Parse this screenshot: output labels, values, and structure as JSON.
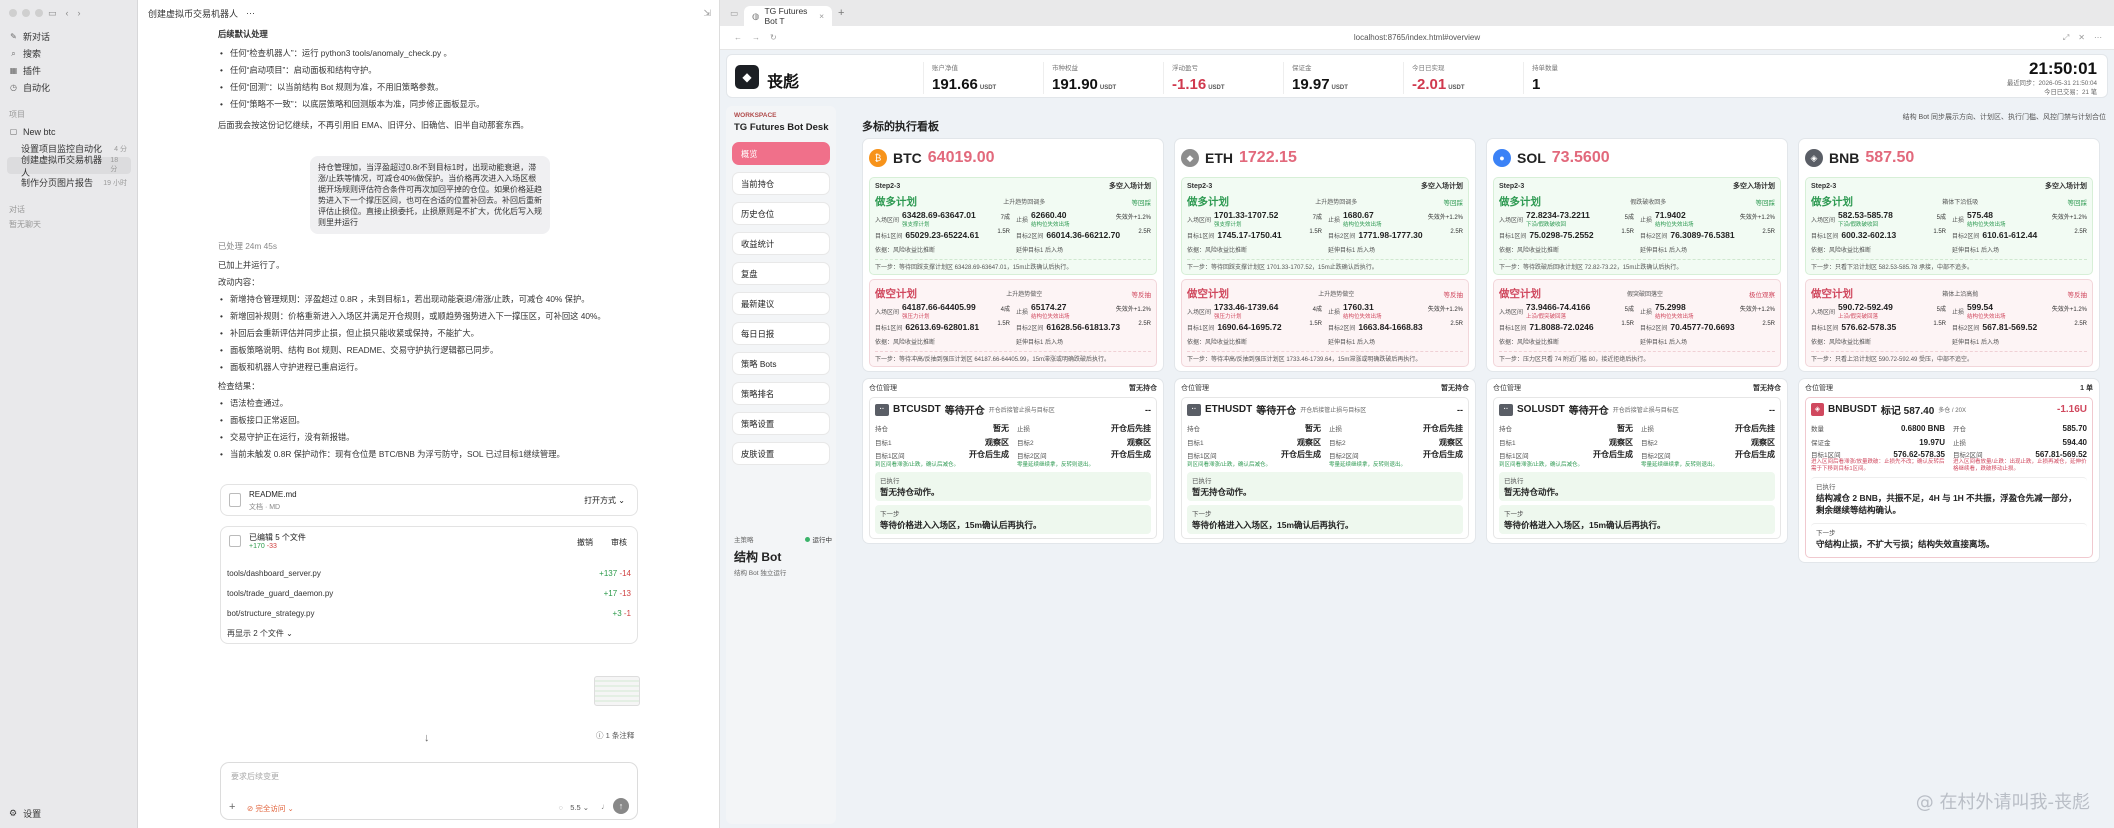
{
  "sidebar": {
    "nav": [
      {
        "icon": "compose-icon",
        "label": "新对话"
      },
      {
        "icon": "search-icon",
        "label": "搜索"
      },
      {
        "icon": "plugin-icon",
        "label": "插件"
      },
      {
        "icon": "automation-icon",
        "label": "自动化"
      }
    ],
    "projects_label": "项目",
    "project_name": "New btc",
    "threads": [
      {
        "label": "设置项目监控自动化",
        "time": "4 分"
      },
      {
        "label": "创建虚拟币交易机器人",
        "time": "18 分"
      },
      {
        "label": "制作分页图片报告",
        "time": "19 小时"
      }
    ],
    "chats_label": "对话",
    "no_chats": "暂无聊天",
    "settings": "设置"
  },
  "chat": {
    "title": "创建虚拟币交易机器人",
    "title_more": "···",
    "section1": "后续默认处理",
    "bullets1": [
      "任何“检查机器人”：运行 python3 tools/anomaly_check.py 。",
      "任何“启动项目”：启动面板和结构守护。",
      "任何“回测”：以当前结构 Bot 规则为准，不用旧策略参数。",
      "任何“策略不一致”：以底层策略和回测版本为准，同步修正面板显示。"
    ],
    "para1": "后面我会按这份记忆继续，不再引用旧 EMA、旧评分、旧确信、旧半自动那套东西。",
    "user_msg": "持仓管理加，当浮盈超过0.8r不到目标1时，出现动能衰退，滞涨/止跌等情况，可减仓40%做保护。当价格再次进入入场区根据开场规则评估符合条件可再次加回平掉的仓位。如果价格延趋势进入下一个撑压区间，也可在合适的位置补回去。补回后重新评估止损位。直接止损委托，止损原则是不扩大，优化后写入规则里并运行",
    "processed": "已处理 24m 45s",
    "done": "已加上并运行了。",
    "changes_label": "改动内容：",
    "bullets2": [
      "新增持仓管理规则：浮盈超过 0.8R ，未到目标1，若出现动能衰退/滞涨/止跌，可减仓 40% 保护。",
      "新增回补规则：价格重新进入入场区并满足开仓规则，或顺趋势强势进入下一撑压区，可补回这 40%。",
      "补回后会重新评估并同步止损，但止损只能收紧或保持，不能扩大。",
      "面板策略说明、结构 Bot 规则、README、交易守护执行逻辑都已同步。",
      "面板和机器人守护进程已重启运行。"
    ],
    "checks_label": "检查结果：",
    "bullets3": [
      "语法检查通过。",
      "面板接口正常返回。",
      "交易守护正在运行，没有新报错。",
      "当前未触发 0.8R 保护动作：现有仓位是 BTC/BNB 为浮亏防守，SOL 已过目标1继续管理。"
    ],
    "readme": {
      "name": "README.md",
      "type": "文档 · MD",
      "open": "打开方式"
    },
    "edited": {
      "title": "已编辑 5 个文件",
      "stats_plus": "+170",
      "stats_minus": "-33",
      "undo": "撤销",
      "review": "审核"
    },
    "files": [
      {
        "name": "tools/dashboard_server.py",
        "plus": "+137",
        "minus": "-14"
      },
      {
        "name": "tools/trade_guard_daemon.py",
        "plus": "+17",
        "minus": "-13"
      },
      {
        "name": "bot/structure_strategy.py",
        "plus": "+3",
        "minus": "-1"
      }
    ],
    "more_files": "再显示 2 个文件",
    "comment": "1 条注释",
    "input_placeholder": "要求后续变更",
    "access": "完全访问",
    "model": "5.5"
  },
  "browser": {
    "tab_title": "TG Futures Bot T",
    "url": "localhost:8765/index.html#overview"
  },
  "app": {
    "brand": "丧彪",
    "stats": [
      {
        "label": "账户净值",
        "value": "191.66",
        "unit": "USDT",
        "neg": false
      },
      {
        "label": "市种权益",
        "value": "191.90",
        "unit": "USDT",
        "neg": false
      },
      {
        "label": "浮动盈亏",
        "value": "-1.16",
        "unit": "USDT",
        "neg": true
      },
      {
        "label": "保证金",
        "value": "19.97",
        "unit": "USDT",
        "neg": false
      },
      {
        "label": "今日已实现",
        "value": "-2.01",
        "unit": "USDT",
        "neg": true
      },
      {
        "label": "持单数量",
        "value": "1",
        "unit": "",
        "neg": false
      }
    ],
    "clock": "21:50:01",
    "clock_sub1": "最近同步：2026-05-31 21:50:04",
    "clock_sub2": "今日已交易：21 笔",
    "workspace": "WORKSPACE",
    "workspace_title": "TG Futures Bot Desk",
    "nav": [
      "概览",
      "当前持仓",
      "历史仓位",
      "收益统计",
      "复盘",
      "最新建议",
      "每日日报",
      "策略 Bots",
      "策略排名",
      "策略设置",
      "皮肤设置"
    ],
    "bot_label": "主策略",
    "bot_status": "运行中",
    "bot_name": "结构 Bot",
    "bot_desc": "结构 Bot 独立运行",
    "main_title": "多标的执行看板",
    "main_note": "结构 Bot 同步展示方向、计划区、执行门槛、风控门禁与计划合位",
    "coins": [
      {
        "name": "BTC",
        "price": "64019.00",
        "color": "#f7931a",
        "icon": "btc-icon",
        "glyph": "₿",
        "step": "Step2-3",
        "step_r": "多空入场计划",
        "long": {
          "title": "做多计划",
          "tag": "上升趋势回调多",
          "status": "等回踩",
          "entry": "63428.69-63647.01",
          "entry_sub": "强支撑计划",
          "sl_tag": "7成",
          "sl": "62660.40",
          "sl_sub": "结构位失效出场",
          "tp_note": "失效外+1.2%",
          "t1": "65029.23-65224.61",
          "t1_rr": "1.5R",
          "t2": "66014.36-66212.70",
          "t2_rr": "2.5R",
          "basis": "依据：风险收益比推断",
          "basis_r": "延伸目标1 后入场",
          "next": "下一步：等待回踩支撑计划区 63428.69-63647.01，15m止跌确认后执行。"
        },
        "short": {
          "title": "做空计划",
          "tag": "上升趋势做空",
          "status": "等反抽",
          "entry": "64187.66-64405.99",
          "entry_sub": "强压力计划",
          "sl_tag": "4成",
          "sl": "65174.27",
          "sl_sub": "结构位失效出场",
          "tp_note": "失效外+1.2%",
          "t1": "62613.69-62801.81",
          "t1_rr": "1.5R",
          "t2": "61628.56-61813.73",
          "t2_rr": "2.5R",
          "basis": "依据：风险收益比推断",
          "basis_r": "延伸目标1 后入场",
          "next": "下一步：等待冲高/反抽到强压计划区 64187.66-64405.99，15m滞涨或明确跌破后执行。"
        },
        "pos_label": "仓位管理",
        "pos_status": "暂无持仓",
        "pos": {
          "sym": "BTCUSDT",
          "state": "等待开仓",
          "dash": "--",
          "hold": "持仓",
          "hold_v": "暂无",
          "stop": "止损",
          "stop_v": "开仓后先挂",
          "t1": "目标1",
          "t1_v": "观察区",
          "t2": "目标2",
          "t2_v": "观察区",
          "t1r": "目标1区间",
          "t1r_v": "开仓后生成",
          "t1r_g": "到区间看滞涨/止跌，确认后减仓。",
          "t2r": "目标2区间",
          "t2r_v": "开仓后生成",
          "t2r_g": "零量延续继续拿，反转则退出。",
          "exec": "已执行",
          "exec_v": "暂无持仓动作。",
          "next": "下一步",
          "next_v": "等待价格进入入场区，15m确认后再执行。"
        }
      },
      {
        "name": "ETH",
        "price": "1722.15",
        "color": "#8c8c8c",
        "icon": "eth-icon",
        "glyph": "◆",
        "step": "Step2-3",
        "step_r": "多空入场计划",
        "long": {
          "title": "做多计划",
          "tag": "上升趋势回调多",
          "status": "等回踩",
          "entry": "1701.33-1707.52",
          "entry_sub": "强支撑计划",
          "sl_tag": "7成",
          "sl": "1680.67",
          "sl_sub": "结构位失效出场",
          "tp_note": "失效外+1.2%",
          "t1": "1745.17-1750.41",
          "t1_rr": "1.5R",
          "t2": "1771.98-1777.30",
          "t2_rr": "2.5R",
          "basis": "依据：风险收益比推断",
          "basis_r": "延伸目标1 后入场",
          "next": "下一步：等待回踩支撑计划区 1701.33-1707.52，15m止跌确认后执行。"
        },
        "short": {
          "title": "做空计划",
          "tag": "上升趋势做空",
          "status": "等反抽",
          "entry": "1733.46-1739.64",
          "entry_sub": "强压力计划",
          "sl_tag": "4成",
          "sl": "1760.31",
          "sl_sub": "结构位失效出场",
          "tp_note": "失效外+1.2%",
          "t1": "1690.64-1695.72",
          "t1_rr": "1.5R",
          "t2": "1663.84-1668.83",
          "t2_rr": "2.5R",
          "basis": "依据：风险收益比推断",
          "basis_r": "延伸目标1 后入场",
          "next": "下一步：等待冲高/反抽到强压计划区 1733.46-1739.64，15m滞涨或明确跌破后再执行。"
        },
        "pos_label": "仓位管理",
        "pos_status": "暂无持仓",
        "pos": {
          "sym": "ETHUSDT",
          "state": "等待开仓",
          "dash": "--",
          "hold": "持仓",
          "hold_v": "暂无",
          "stop": "止损",
          "stop_v": "开仓后先挂",
          "t1": "目标1",
          "t1_v": "观察区",
          "t2": "目标2",
          "t2_v": "观察区",
          "t1r": "目标1区间",
          "t1r_v": "开仓后生成",
          "t1r_g": "到区间看滞涨/止跌，确认后减仓。",
          "t2r": "目标2区间",
          "t2r_v": "开仓后生成",
          "t2r_g": "零量延续继续拿，反转则退出。",
          "exec": "已执行",
          "exec_v": "暂无持仓动作。",
          "next": "下一步",
          "next_v": "等待价格进入入场区，15m确认后再执行。"
        }
      },
      {
        "name": "SOL",
        "price": "73.5600",
        "color": "#3b82f6",
        "icon": "sol-icon",
        "glyph": "●",
        "step": "Step2-3",
        "step_r": "多空入场计划",
        "long": {
          "title": "做多计划",
          "tag": "假跌破收回多",
          "status": "等回踩",
          "entry": "72.8234-73.2211",
          "entry_sub": "下沿/假跌破收回",
          "sl_tag": "5成",
          "sl": "71.9402",
          "sl_sub": "结构位失效出场",
          "tp_note": "失效外+1.2%",
          "t1": "75.0298-75.2552",
          "t1_rr": "1.5R",
          "t2": "76.3089-76.5381",
          "t2_rr": "2.5R",
          "basis": "依据：风险收益比推断",
          "basis_r": "延伸目标1 后入场",
          "next": "下一步：等待跌破后回收计划区 72.82-73.22，15m止跌确认后执行。"
        },
        "short": {
          "title": "做空计划",
          "tag": "假突破回落空",
          "status": "极位观察",
          "entry": "73.9466-74.4166",
          "entry_sub": "上沿/假突破回落",
          "sl_tag": "5成",
          "sl": "75.2998",
          "sl_sub": "结构位失效出场",
          "tp_note": "失效外+1.2%",
          "t1": "71.8088-72.0246",
          "t1_rr": "1.5R",
          "t2": "70.4577-70.6693",
          "t2_rr": "2.5R",
          "basis": "依据：风险收益比推断",
          "basis_r": "延伸目标1 后入场",
          "next": "下一步：压力区只看 74 附近门槛 80，接近拒绝后执行。"
        },
        "pos_label": "仓位管理",
        "pos_status": "暂无持仓",
        "pos": {
          "sym": "SOLUSDT",
          "state": "等待开仓",
          "dash": "--",
          "hold": "持仓",
          "hold_v": "暂无",
          "stop": "止损",
          "stop_v": "开仓后先挂",
          "t1": "目标1",
          "t1_v": "观察区",
          "t2": "目标2",
          "t2_v": "观察区",
          "t1r": "目标1区间",
          "t1r_v": "开仓后生成",
          "t1r_g": "到区间看滞涨/止跌，确认后减仓。",
          "t2r": "目标2区间",
          "t2r_v": "开仓后生成",
          "t2r_g": "零量延续继续拿，反转则退出。",
          "exec": "已执行",
          "exec_v": "暂无持仓动作。",
          "next": "下一步",
          "next_v": "等待价格进入入场区，15m确认后再执行。"
        }
      },
      {
        "name": "BNB",
        "price": "587.50",
        "color": "#5a5e66",
        "icon": "bnb-icon",
        "glyph": "◈",
        "step": "Step2-3",
        "step_r": "多空入场计划",
        "long": {
          "title": "做多计划",
          "tag": "箱体下沿低吸",
          "status": "等回踩",
          "entry": "582.53-585.78",
          "entry_sub": "下沿/假跌破收回",
          "sl_tag": "5成",
          "sl": "575.48",
          "sl_sub": "结构位失效出场",
          "tp_note": "失效外+1.2%",
          "t1": "600.32-602.13",
          "t1_rr": "1.5R",
          "t2": "610.61-612.44",
          "t2_rr": "2.5R",
          "basis": "依据：风险收益比推断",
          "basis_r": "延伸目标1 后入场",
          "next": "下一步：只看下沿计划区 582.53-585.78 承接，中部不追多。"
        },
        "short": {
          "title": "做空计划",
          "tag": "箱体上沿高抛",
          "status": "等反抽",
          "entry": "590.72-592.49",
          "entry_sub": "上沿/假突破回落",
          "sl_tag": "5成",
          "sl": "599.54",
          "sl_sub": "结构位失效出场",
          "tp_note": "失效外+1.2%",
          "t1": "576.62-578.35",
          "t1_rr": "1.5R",
          "t2": "567.81-569.52",
          "t2_rr": "2.5R",
          "basis": "依据：风险收益比推断",
          "basis_r": "延伸目标1 后入场",
          "next": "下一步：只看上沿计划区 590.72-592.49 受压，中部不追空。"
        },
        "pos_label": "仓位管理",
        "pos_status": "1 单",
        "bnbpos": {
          "sym": "BNBUSDT",
          "mark": "标记 587.40",
          "side": "多仓 / 20X",
          "pnl": "-1.16U",
          "qty": "数量",
          "qty_v": "0.6800 BNB",
          "open": "开仓",
          "open_v": "585.70",
          "margin": "保证金",
          "margin_v": "19.97U",
          "stop": "止损",
          "stop_v": "594.40",
          "t1r": "目标1区间",
          "t1r_v": "576.62-578.35",
          "t1r_n": "进入区间后看滞涨/放量跌破：止损先不改；确认反转后需于下移到目标1区间。",
          "t2r": "目标2区间",
          "t2r_v": "567.81-569.52",
          "t2r_n": "进入区间看放量/止跌：出现止跌，止损再减仓，延伸价格继续看，跌破移动止损。",
          "exec": "已执行",
          "exec_v": "结构减仓 2 BNB，共振不足，4H 与 1H 不共振，浮盈仓先减一部分，剩余继续等结构确认。",
          "next": "下一步",
          "next_v": "守结构止损，不扩大亏损；结构失效直接离场。"
        }
      }
    ],
    "watermark": "@ 在村外请叫我-丧彪"
  }
}
